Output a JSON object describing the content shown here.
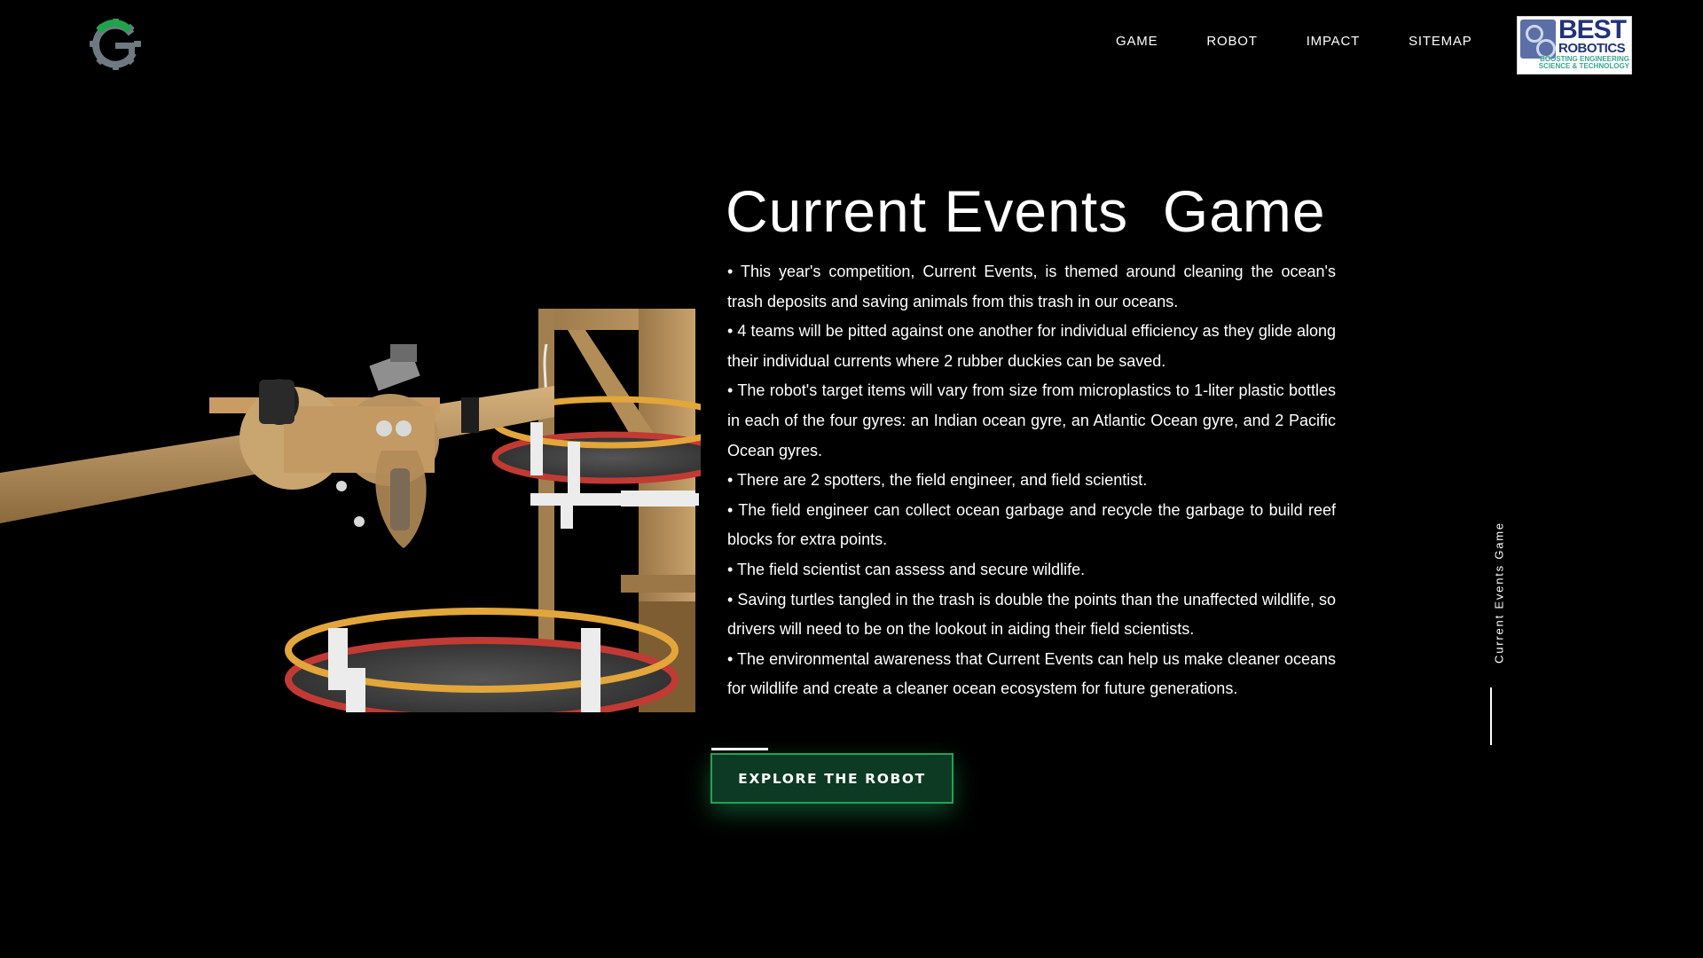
{
  "header": {
    "logo_icon": "gear-g-logo",
    "nav": [
      {
        "label": "GAME"
      },
      {
        "label": "ROBOT"
      },
      {
        "label": "IMPACT"
      },
      {
        "label": "SITEMAP"
      }
    ],
    "partner_logo": {
      "word1": "BEST",
      "word2": "ROBOTICS",
      "tagline_line1": "BOOSTING ENGINEERING",
      "tagline_line2": "SCIENCE & TECHNOLOGY"
    }
  },
  "main": {
    "title": "Current Events  Game",
    "bullets": [
      "• This year's competition, Current Events, is themed around cleaning the ocean's trash deposits and saving animals from this trash in our oceans.",
      "• 4 teams will be pitted against one another for individual efficiency as they glide along their individual currents where 2 rubber duckies can be saved.",
      "• The robot's target items will vary from size from microplastics to 1-liter plastic bottles in each of the four gyres: an Indian ocean gyre, an Atlantic Ocean gyre, and 2 Pacific Ocean gyres.",
      "• There are 2 spotters, the field engineer, and field scientist.",
      "• The field engineer can collect ocean garbage and recycle the garbage to build reef blocks for extra points.",
      "• The field scientist can assess and secure wildlife.",
      "• Saving turtles tangled in the trash is double the points than the unaffected wildlife, so drivers will need to be on the lookout in aiding their field scientists.",
      "• The environmental awareness that Current Events can help us make cleaner oceans for wildlife and create a cleaner ocean ecosystem for future generations."
    ],
    "cta_label": "EXPLORE THE ROBOT"
  },
  "side_indicator": {
    "label": "Current Events Game"
  },
  "colors": {
    "background": "#000000",
    "text": "#ffffff",
    "cta_fill": "#0d3a22",
    "cta_border": "#20a35a",
    "logo_green": "#1fa34a",
    "logo_gray": "#6f7a80"
  }
}
